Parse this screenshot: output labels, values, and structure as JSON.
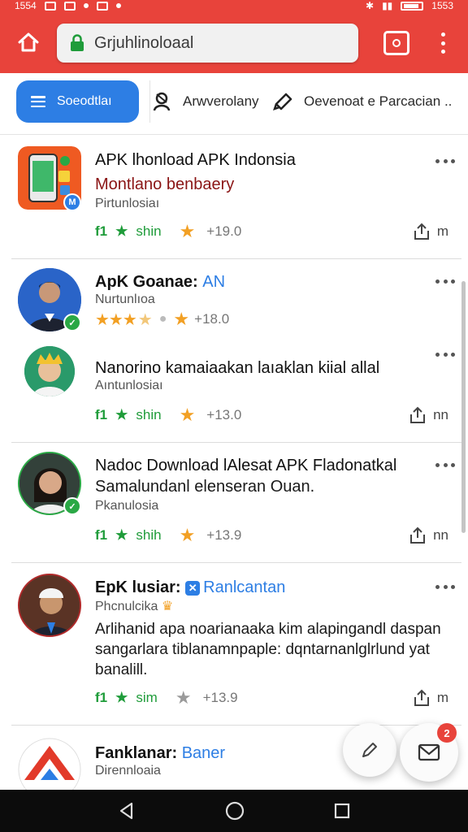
{
  "status_bar": {
    "time_left": "1554",
    "time_right": "1553"
  },
  "browser": {
    "url": "Grjuhlinoloaal"
  },
  "filters": [
    {
      "label": "Soeodtlaı",
      "icon": "menu-icon",
      "active": true
    },
    {
      "label": "Arwverolany",
      "icon": "person-icon",
      "active": false
    },
    {
      "label": "Oevenoat e Parcacian ..",
      "icon": "megaphone-icon",
      "active": false
    }
  ],
  "posts": [
    {
      "title": "APK lhonload APK Indonsia",
      "subtitle": "Montlano benbaery",
      "meta": "Pirtunlosiaı",
      "like_count": "shin",
      "rating": "+19.0",
      "share_count": "m"
    },
    {
      "title": "ApK Goanae:",
      "title_suffix": "AN",
      "meta": "Nurtunlıoa",
      "rating": "+18.0"
    },
    {
      "title": "Nanorino kamaiaakan laıaklan kiial allal",
      "meta": "Aıntunlosiaı",
      "like_count": "shin",
      "rating": "+13.0",
      "share_count": "nn"
    },
    {
      "title": "Nadoc Download lAlesat APK Fladonatkal",
      "subtitle": "Samalundanl elenseran Ouan.",
      "meta": "Pkanulosia",
      "like_count": "shih",
      "rating": "+13.9",
      "share_count": "nn"
    },
    {
      "title": "EpK lusiar:",
      "title_suffix": "Ranlcantan",
      "meta": "Phcnulcika",
      "body": "Arlihanid apa noarianaaka kim alapingandl daspan sangarlara tiblanamnpaple: dqntarnanlglrlund yat banalill.",
      "like_count": "sim",
      "rating": "+13.9",
      "share_count": "m"
    },
    {
      "title": "Fanklanar:",
      "title_suffix": "Baner",
      "meta": "Dirennloaia"
    }
  ],
  "fab": {
    "badge": "2"
  },
  "colors": {
    "brand_red": "#e8433b",
    "accent_blue": "#2d7ee4",
    "green": "#1f9c3a",
    "star": "#f2a024",
    "star_gray": "#9a9a9a"
  }
}
